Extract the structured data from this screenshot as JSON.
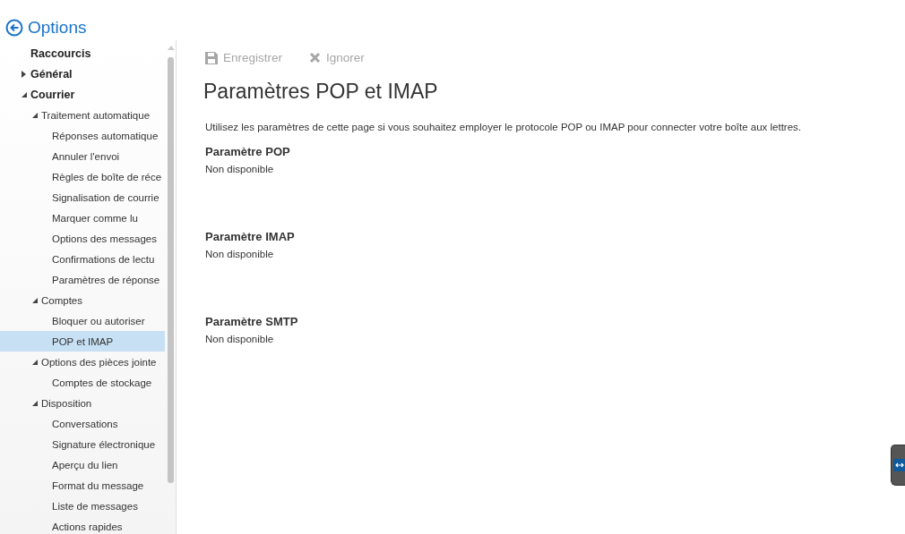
{
  "header": {
    "title": "Options"
  },
  "sidebar": {
    "items": [
      {
        "label": "Raccourcis",
        "selected": false
      },
      {
        "label": "Général",
        "selected": false,
        "expanded": false
      },
      {
        "label": "Courrier",
        "selected": false,
        "expanded": true,
        "children": [
          {
            "label": "Traitement automatique",
            "selected": false,
            "expanded": true,
            "children": [
              {
                "label": "Réponses automatique",
                "selected": false
              },
              {
                "label": "Annuler l'envoi",
                "selected": false
              },
              {
                "label": "Règles de boîte de réce",
                "selected": false
              },
              {
                "label": "Signalisation de courrie",
                "selected": false
              },
              {
                "label": "Marquer comme lu",
                "selected": false
              },
              {
                "label": "Options des messages",
                "selected": false
              },
              {
                "label": "Confirmations de lectu",
                "selected": false
              },
              {
                "label": "Paramètres de réponse",
                "selected": false
              }
            ]
          },
          {
            "label": "Comptes",
            "selected": false,
            "expanded": true,
            "children": [
              {
                "label": "Bloquer ou autoriser",
                "selected": false
              },
              {
                "label": "POP et IMAP",
                "selected": true
              }
            ]
          },
          {
            "label": "Options des pièces jointe",
            "selected": false,
            "expanded": true,
            "children": [
              {
                "label": "Comptes de stockage",
                "selected": false
              }
            ]
          },
          {
            "label": "Disposition",
            "selected": false,
            "expanded": true,
            "children": [
              {
                "label": "Conversations",
                "selected": false
              },
              {
                "label": "Signature électronique",
                "selected": false
              },
              {
                "label": "Aperçu du lien",
                "selected": false
              },
              {
                "label": "Format du message",
                "selected": false
              },
              {
                "label": "Liste de messages",
                "selected": false
              },
              {
                "label": "Actions rapides",
                "selected": false
              }
            ]
          }
        ]
      }
    ]
  },
  "toolbar": [
    {
      "kind": "save",
      "label": "Enregistrer",
      "disabled": true
    },
    {
      "kind": "discard",
      "label": "Ignorer",
      "disabled": true
    }
  ],
  "page": {
    "title": "Paramètres POP et IMAP",
    "description": "Utilisez les paramètres de cette page si vous souhaitez employer le protocole POP ou IMAP pour connecter votre boîte aux lettres.",
    "sections": [
      {
        "heading": "Paramètre POP",
        "value": "Non disponible"
      },
      {
        "heading": "Paramètre IMAP",
        "value": "Non disponible"
      },
      {
        "heading": "Paramètre SMTP",
        "value": "Non disponible"
      }
    ]
  }
}
